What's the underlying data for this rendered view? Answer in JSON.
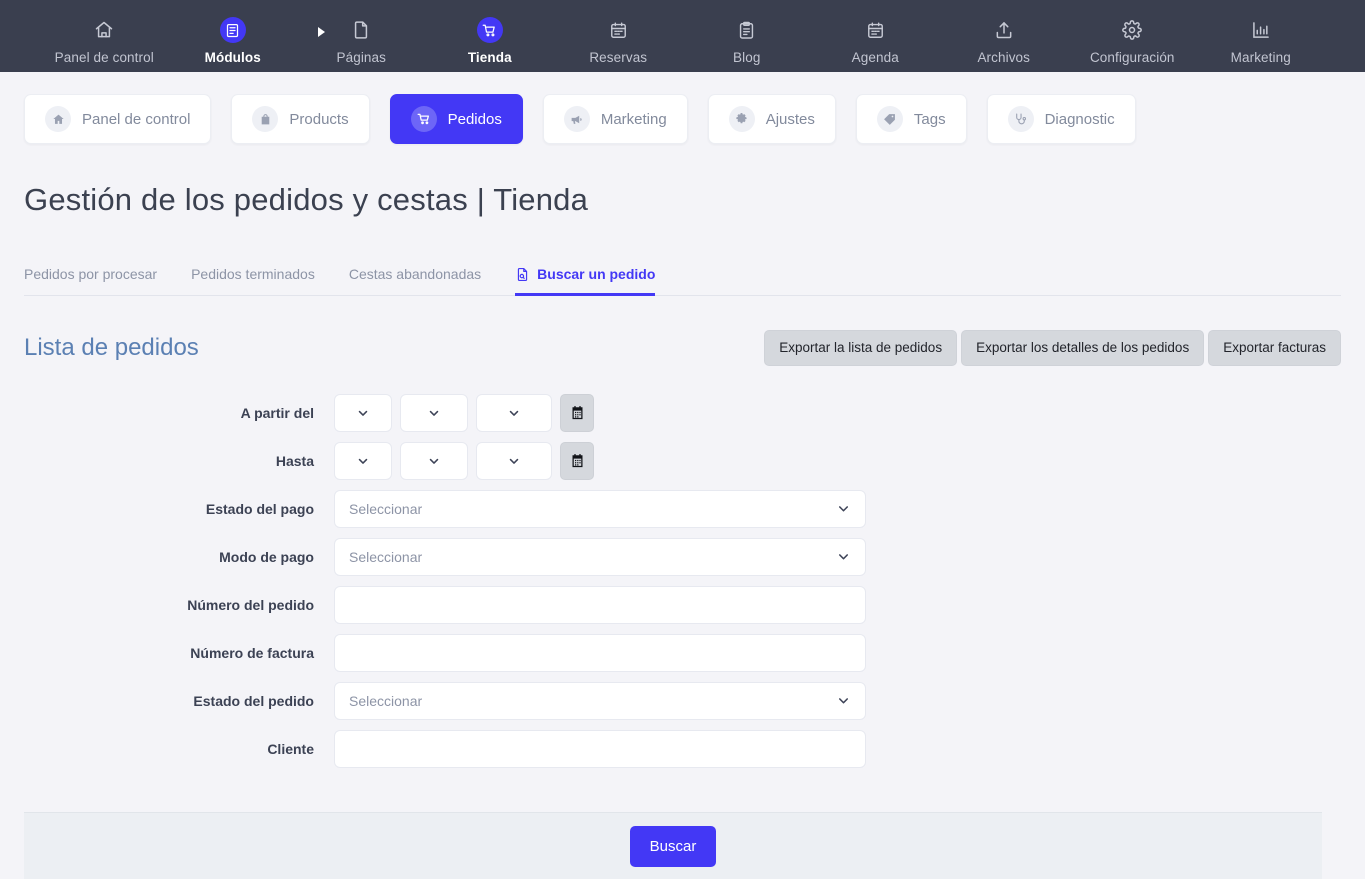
{
  "topnav": {
    "items": [
      {
        "label": "Panel de control",
        "icon": "home-icon",
        "active": false
      },
      {
        "label": "Módulos",
        "icon": "modules-icon",
        "active": true
      },
      {
        "label": "Páginas",
        "icon": "page-icon",
        "active": false
      },
      {
        "label": "Tienda",
        "icon": "cart-icon",
        "active": true
      },
      {
        "label": "Reservas",
        "icon": "calendar-icon",
        "active": false
      },
      {
        "label": "Blog",
        "icon": "clipboard-icon",
        "active": false
      },
      {
        "label": "Agenda",
        "icon": "calendar-days-icon",
        "active": false
      },
      {
        "label": "Archivos",
        "icon": "upload-icon",
        "active": false
      },
      {
        "label": "Configuración",
        "icon": "gear-icon",
        "active": false
      },
      {
        "label": "Marketing",
        "icon": "bar-chart-icon",
        "active": false
      }
    ]
  },
  "pillbar": {
    "items": [
      {
        "label": "Panel de control",
        "icon": "home-icon",
        "active": false
      },
      {
        "label": "Products",
        "icon": "bag-icon",
        "active": false
      },
      {
        "label": "Pedidos",
        "icon": "cart-icon",
        "active": true
      },
      {
        "label": "Marketing",
        "icon": "megaphone-icon",
        "active": false
      },
      {
        "label": "Ajustes",
        "icon": "gear-icon",
        "active": false
      },
      {
        "label": "Tags",
        "icon": "tag-icon",
        "active": false
      },
      {
        "label": "Diagnostic",
        "icon": "stethoscope-icon",
        "active": false
      }
    ]
  },
  "page": {
    "title": "Gestión de los pedidos y cestas | Tienda"
  },
  "tabs": [
    {
      "label": "Pedidos por procesar",
      "active": false,
      "icon": ""
    },
    {
      "label": "Pedidos terminados",
      "active": false,
      "icon": ""
    },
    {
      "label": "Cestas abandonadas",
      "active": false,
      "icon": ""
    },
    {
      "label": "Buscar un pedido",
      "active": true,
      "icon": "document-search-icon"
    }
  ],
  "section": {
    "title": "Lista de pedidos",
    "export_buttons": [
      "Exportar la lista de pedidos",
      "Exportar los detalles de los pedidos",
      "Exportar facturas"
    ]
  },
  "form": {
    "date_from": {
      "label": "A partir del",
      "day": "",
      "month": "",
      "year": "",
      "calendar_icon": "calendar-icon"
    },
    "date_to": {
      "label": "Hasta",
      "day": "",
      "month": "",
      "year": "",
      "calendar_icon": "calendar-icon"
    },
    "payment_status": {
      "label": "Estado del pago",
      "value": "",
      "placeholder": "Seleccionar"
    },
    "payment_method": {
      "label": "Modo de pago",
      "value": "",
      "placeholder": "Seleccionar"
    },
    "order_number": {
      "label": "Número del pedido",
      "value": "",
      "placeholder": ""
    },
    "invoice_number": {
      "label": "Número de factura",
      "value": "",
      "placeholder": ""
    },
    "order_status": {
      "label": "Estado del pedido",
      "value": "",
      "placeholder": "Seleccionar"
    },
    "customer": {
      "label": "Cliente",
      "value": "",
      "placeholder": ""
    }
  },
  "footer": {
    "search_label": "Buscar"
  },
  "colors": {
    "accent": "#4338f5",
    "topbar": "#3a3f4f",
    "page_bg": "#f4f4f8",
    "section_title": "#5b80b3",
    "export_btn": "#d5d8dd",
    "footer_bg": "#eceff3"
  }
}
